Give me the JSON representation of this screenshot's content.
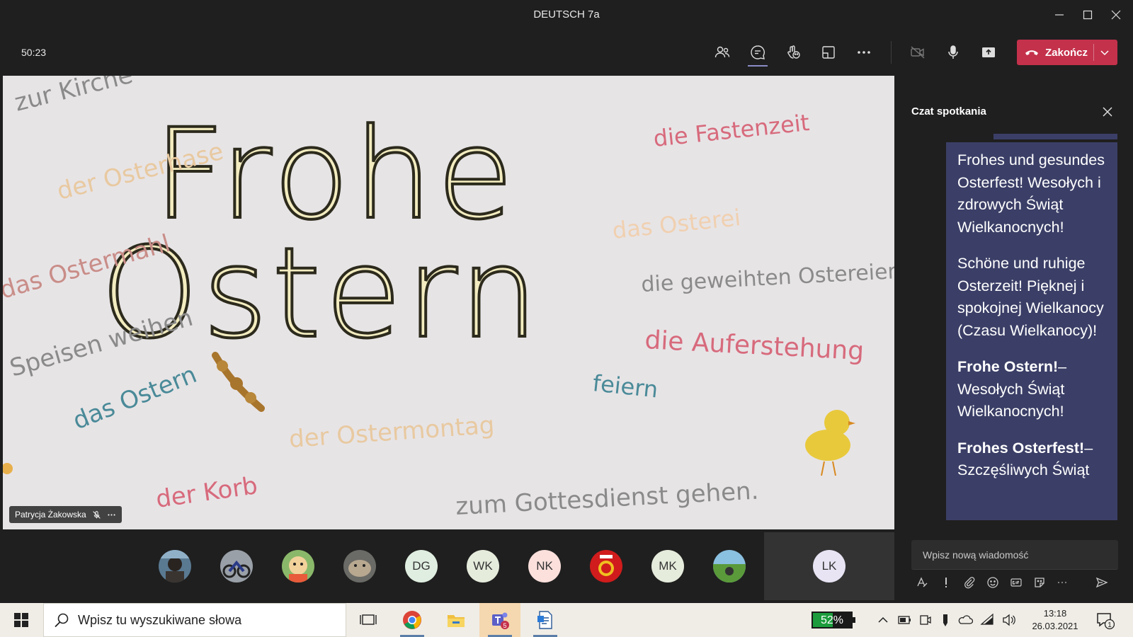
{
  "window": {
    "title": "DEUTSCH 7a"
  },
  "toolbar": {
    "timer": "50:23",
    "end_label": "Zakończ"
  },
  "board": {
    "title_line1": "Frohe",
    "title_line2": "Ostern",
    "words": {
      "kirche": "zur Kirche",
      "osterhase": "der Osterhase",
      "ostermahl": "das Ostermahl",
      "speisen": "Speisen weihen",
      "das_ostern": "das Ostern",
      "ostermontag": "der Ostermontag",
      "korb": "der Korb",
      "gottesdienst": "zum Gottesdienst gehen.",
      "fastenzeit": "die Fastenzeit",
      "osterei": "das Osterei",
      "ostereier": "die geweihten Ostereier",
      "auferstehung": "die Auferstehung",
      "feiern": "feiern"
    }
  },
  "video": {
    "participant_name": "Patrycja Żakowska"
  },
  "chat": {
    "header": "Czat spotkania",
    "msg1": "Frohes und gesundes Osterfest! Wesołych i zdrowych Świąt Wielkanocnych!",
    "msg2": "Schöne und ruhige Osterzeit! Pięknej i spokojnej Wielkanocy (Czasu Wielkanocy)!",
    "msg3_bold": "Frohe Ostern!",
    "msg3_rest": "– Wesołych Świąt Wielkanocnych!",
    "msg4_bold": "Frohes Osterfest!",
    "msg4_rest": "– Szczęśliwych Świąt",
    "input_placeholder": "Wpisz nową wiadomość"
  },
  "participants": [
    "DG",
    "WK",
    "NK",
    "MK",
    "LK"
  ],
  "taskbar": {
    "search_placeholder": "Wpisz tu wyszukiwane słowa",
    "battery": "52%",
    "battery_level": 0.52,
    "time": "13:18",
    "date": "26.03.2021",
    "teams_badge": "5",
    "notif_count": "1"
  },
  "colors": {
    "end_button": "#c4314b",
    "chat_bubble": "#3b3f67",
    "accent": "#8b8cc7"
  }
}
